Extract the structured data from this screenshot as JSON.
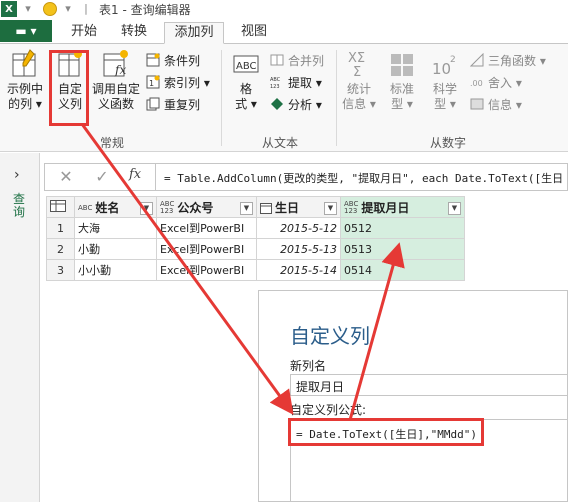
{
  "window": {
    "title": "表1 - 查询编辑器",
    "app_icon": "X"
  },
  "tabs": {
    "file": "▬ ▾",
    "home": "开始",
    "transform": "转换",
    "add_column": "添加列",
    "view": "视图"
  },
  "ribbon": {
    "col_from_examples": "示例中\n的列 ▾",
    "custom_column": "自定\n义列",
    "invoke_custom_function": "调用自定\n义函数",
    "conditional_column": "条件列",
    "index_column": "索引列 ▾",
    "duplicate_column": "重复列",
    "group_general": "常规",
    "format": "格\n式 ▾",
    "merge_columns": "合并列",
    "extract": "提取 ▾",
    "parse": "分析 ▾",
    "group_from_text": "从文本",
    "statistics": "统计\n信息 ▾",
    "standard": "标准\n型 ▾",
    "scientific": "科学\n型 ▾",
    "trigonometry": "三角函数 ▾",
    "rounding": "舍入 ▾",
    "information": "信息 ▾",
    "group_from_number": "从数字"
  },
  "left_nav": {
    "label": "查询"
  },
  "formula_bar": {
    "fx": "fx",
    "text": "= Table.AddColumn(更改的类型, \"提取月日\", each Date.ToText([生日"
  },
  "table": {
    "columns": [
      {
        "type": "ABC",
        "name": "姓名"
      },
      {
        "type": "ABC\n123",
        "name": "公众号"
      },
      {
        "type": "",
        "name": "生日"
      },
      {
        "type": "ABC\n123",
        "name": "提取月日"
      }
    ],
    "rows": [
      {
        "n": "1",
        "name": "大海",
        "account": "Excel到PowerBI",
        "birthday": "2015-5-12",
        "md": "0512"
      },
      {
        "n": "2",
        "name": "小勤",
        "account": "Excel到PowerBI",
        "birthday": "2015-5-13",
        "md": "0513"
      },
      {
        "n": "3",
        "name": "小小勤",
        "account": "Excel到PowerBI",
        "birthday": "2015-5-14",
        "md": "0514"
      }
    ]
  },
  "dialog": {
    "title": "自定义列",
    "new_col_label": "新列名",
    "new_col_value": "提取月日",
    "formula_label": "自定义列公式:",
    "formula_value": "= Date.ToText([生日],\"MMdd\")"
  },
  "colors": {
    "accent": "#1e7145",
    "selected_col": "#d6eedf",
    "annotation": "#e53935",
    "dialog_title": "#2b5d8a"
  }
}
